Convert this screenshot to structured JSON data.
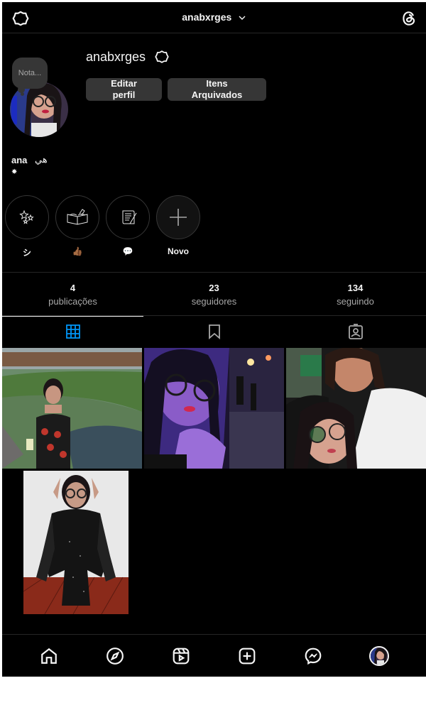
{
  "header": {
    "username": "anabxrges"
  },
  "profile": {
    "name": "anabxrges",
    "note_label": "Nota...",
    "edit_button_line1": "Editar",
    "edit_button_line2": "perfil",
    "archive_button_line1": "Itens",
    "archive_button_line2": "Arquivados",
    "bio_name": "ana",
    "bio_extra": "ﻫﻲ",
    "bio_line2": "✸"
  },
  "highlights": [
    {
      "label": "シ",
      "icon": "sparkles-icon"
    },
    {
      "label": "👍🏾",
      "icon": "open-book-icon"
    },
    {
      "label": "💬",
      "icon": "scroll-quill-icon"
    },
    {
      "label": "Novo",
      "icon": "plus-icon"
    }
  ],
  "stats": [
    {
      "value": "4",
      "label": "publicações"
    },
    {
      "value": "23",
      "label": "seguidores"
    },
    {
      "value": "134",
      "label": "seguindo"
    }
  ],
  "tabs": [
    {
      "name": "grid-tab",
      "icon": "grid-icon",
      "active": true
    },
    {
      "name": "saved-tab",
      "icon": "bookmark-icon",
      "active": false
    },
    {
      "name": "tagged-tab",
      "icon": "tagged-person-icon",
      "active": false
    }
  ],
  "posts": [
    {
      "description": "woman by lake with drink"
    },
    {
      "description": "selfie with glasses at night fair"
    },
    {
      "description": "selfie with older woman"
    },
    {
      "description": "woman in black sparkly dress"
    }
  ],
  "bottom_nav": [
    "home-icon",
    "explore-icon",
    "reels-icon",
    "create-icon",
    "messenger-icon",
    "profile-avatar"
  ],
  "colors": {
    "background": "#000000",
    "button": "#363636",
    "divider": "#262626",
    "active_tab": "#0095f6",
    "text": "#f5f5f5",
    "muted": "#a8a8a8"
  }
}
